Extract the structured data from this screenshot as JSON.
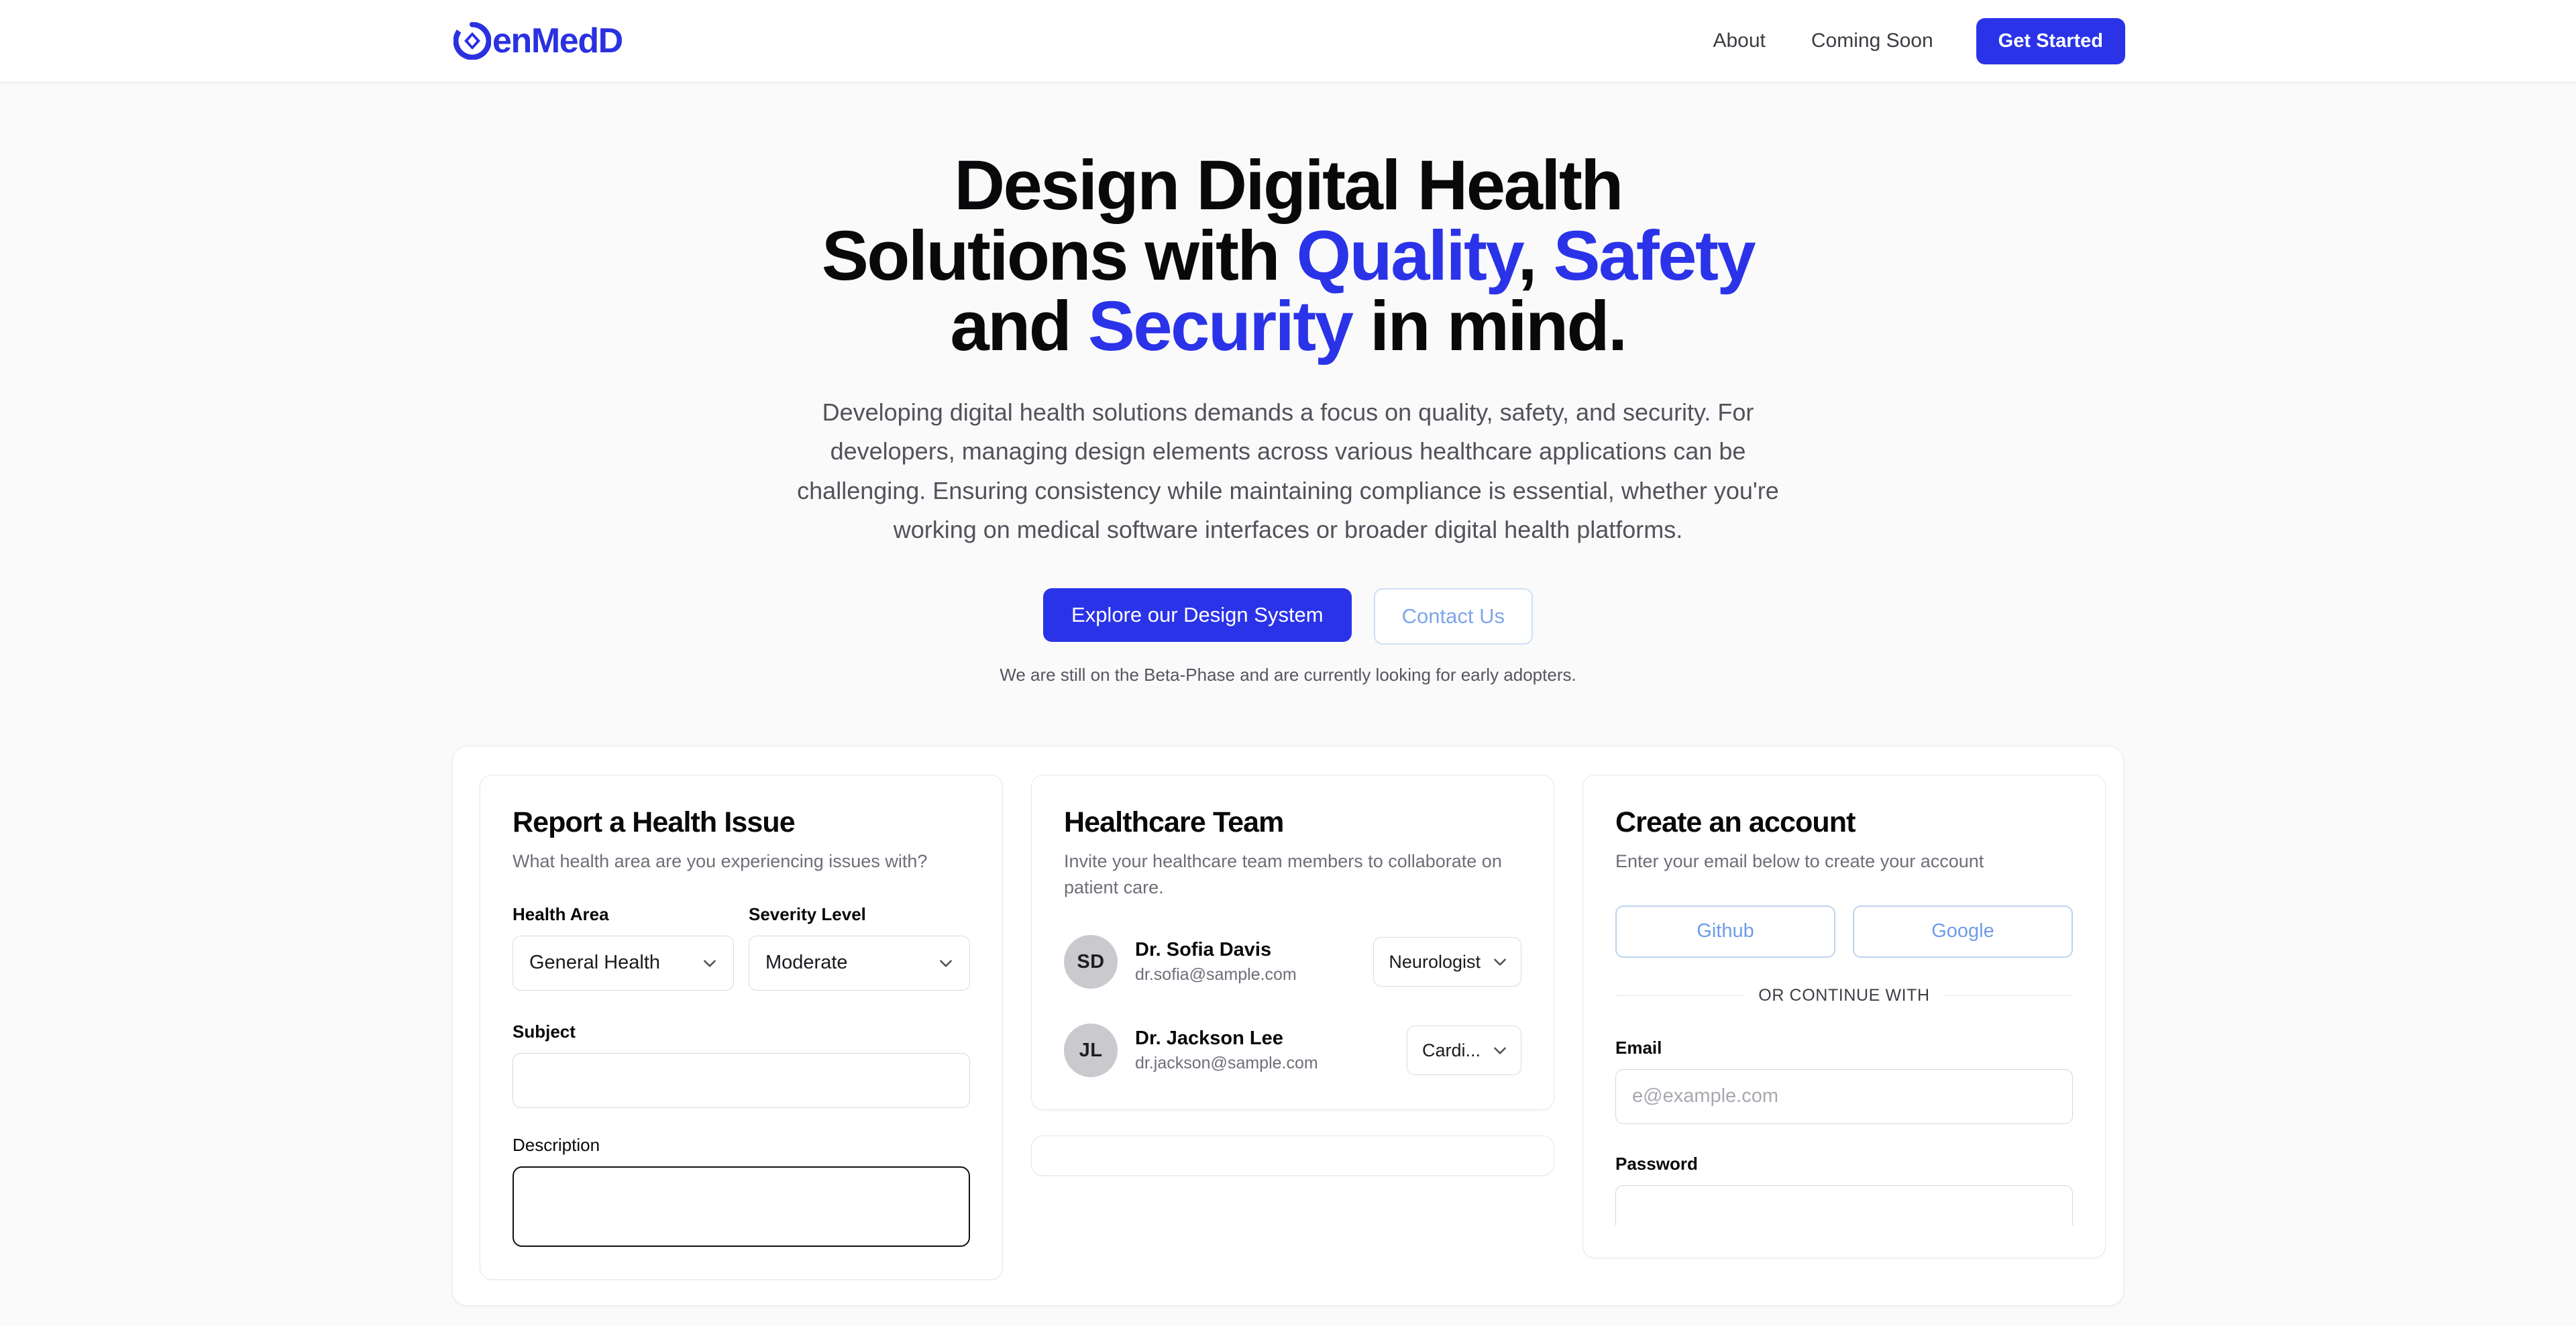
{
  "header": {
    "brand_name": "enMedD",
    "brand_icon": "gem-circle-logo-icon",
    "nav": [
      {
        "label": "About"
      },
      {
        "label": "Coming Soon"
      }
    ],
    "cta_label": "Get Started"
  },
  "hero": {
    "title_line1": "Design Digital Health",
    "title_line2_a": "Solutions with ",
    "title_line2_hl1": "Quality",
    "title_line2_comma": ", ",
    "title_line2_hl2": "Safety",
    "title_line3_a": "and ",
    "title_line3_hl": "Security",
    "title_line3_b": " in mind.",
    "paragraph": "Developing digital health solutions demands a focus on quality, safety, and security. For developers, managing design elements across various healthcare applications can be challenging. Ensuring consistency while maintaining compliance is essential, whether you're working on medical software interfaces or broader digital health platforms.",
    "primary_cta": "Explore our Design System",
    "secondary_cta": "Contact Us",
    "note": "We are still on the Beta-Phase and are currently looking for early adopters."
  },
  "report_card": {
    "title": "Report a Health Issue",
    "description": "What health area are you experiencing issues with?",
    "health_area_label": "Health Area",
    "health_area_value": "General Health",
    "severity_label": "Severity Level",
    "severity_value": "Moderate",
    "subject_label": "Subject",
    "subject_value": "",
    "subject_placeholder": "",
    "description_label": "Description"
  },
  "team_card": {
    "title": "Healthcare Team",
    "description": "Invite your healthcare team members to collaborate on patient care.",
    "members": [
      {
        "initials": "SD",
        "name": "Dr. Sofia Davis",
        "email": "dr.sofia@sample.com",
        "role": "Neurologist"
      },
      {
        "initials": "JL",
        "name": "Dr. Jackson Lee",
        "email": "dr.jackson@sample.com",
        "role": "Cardi..."
      }
    ]
  },
  "account_card": {
    "title": "Create an account",
    "description": "Enter your email below to create your account",
    "github_label": "Github",
    "google_label": "Google",
    "divider_label": "OR CONTINUE WITH",
    "email_label": "Email",
    "email_value": "",
    "email_placeholder": "e@example.com",
    "password_label": "Password"
  },
  "colors": {
    "brand_blue": "#2b33e8",
    "page_bg": "#fafafa",
    "card_bg": "#ffffff",
    "muted_text": "#6e6e78",
    "oauth_blue": "#6f9ce8"
  }
}
